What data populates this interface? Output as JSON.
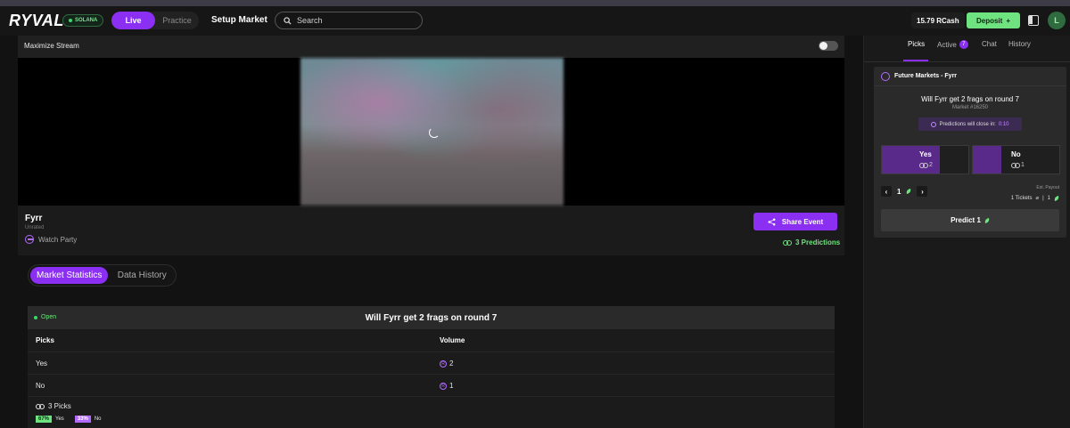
{
  "app": {
    "logo_text": "RYVAL",
    "chain": "SOLANA"
  },
  "nav": {
    "modes": [
      "Live",
      "Practice"
    ],
    "setup_label": "Setup Market",
    "search_placeholder": "Search",
    "balance": "15.79 RCash",
    "deposit_label": "Deposit",
    "deposit_plus": "+",
    "avatar_initial": "L"
  },
  "stream": {
    "maximize_label": "Maximize Stream",
    "streamer_name": "Fyrr",
    "streamer_status": "Unrated",
    "watch_party": "Watch Party",
    "share_label": "Share Event",
    "predictions": "3 Predictions"
  },
  "stats_tabs": [
    "Market Statistics",
    "Data History"
  ],
  "market_table": {
    "status": "Open",
    "title": "Will Fyrr get 2 frags on round 7",
    "col_picks": "Picks",
    "col_volume": "Volume",
    "rows": [
      {
        "pick": "Yes",
        "volume": "2"
      },
      {
        "pick": "No",
        "volume": "1"
      }
    ],
    "picks_summary": "3 Picks",
    "yes_pct": "67%",
    "yes_label": "Yes",
    "no_pct": "33%",
    "no_label": "No"
  },
  "right_panel": {
    "tabs": [
      "Picks",
      "Active",
      "Chat",
      "History"
    ],
    "active_count": "7",
    "card_title": "Future Markets - Fyrr",
    "question": "Will Fyrr get 2 frags on round 7",
    "market_id": "Market #16250",
    "timer_label": "Predictions will close in:",
    "timer_value": "0:10",
    "choices": [
      {
        "label": "Yes",
        "count": "2",
        "fill_fraction": 0.67
      },
      {
        "label": "No",
        "count": "1",
        "fill_fraction": 0.33
      }
    ],
    "quantity": "1",
    "est_payout_label": "Est. Payout",
    "tickets": "1 Tickets",
    "payout_value": "1",
    "predict_label": "Predict 1"
  }
}
